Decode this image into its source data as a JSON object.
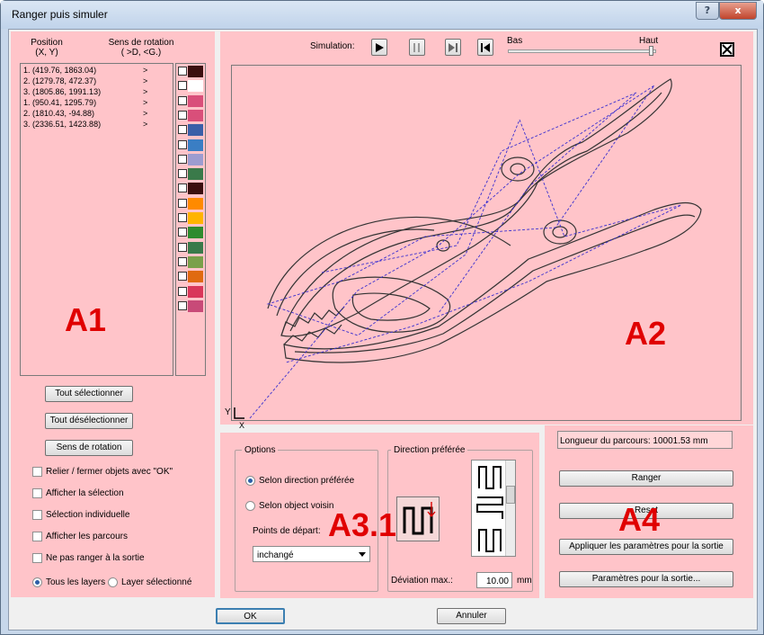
{
  "window": {
    "title": "Ranger puis simuler",
    "help_label": "?",
    "close_label": "x"
  },
  "a1": {
    "col1_header": "Position",
    "col1_sub": "(X, Y)",
    "col2_header": "Sens de rotation",
    "col2_sub": "( >D, <G.)",
    "rows": [
      {
        "pos": "1. (419.76, 1863.04)",
        "dir": ">"
      },
      {
        "pos": "2. (1279.78, 472.37)",
        "dir": ">"
      },
      {
        "pos": "3. (1805.86, 1991.13)",
        "dir": ">"
      },
      {
        "pos": "1. (950.41, 1295.79)",
        "dir": ">"
      },
      {
        "pos": "2. (1810.43, -94.88)",
        "dir": ">"
      },
      {
        "pos": "3. (2336.51, 1423.88)",
        "dir": ">"
      }
    ],
    "label": "A1",
    "layer_colors": [
      "#3b0f0f",
      "#ffffff",
      "#d94f7a",
      "#d94f7a",
      "#3a5fa8",
      "#3a7ec4",
      "#9d9cd0",
      "#3a7a4a",
      "#3b0f0f",
      "#ff8a00",
      "#ffb400",
      "#2e8b2e",
      "#3a7a4a",
      "#7aa04a",
      "#e06a10",
      "#d9365a",
      "#c84a78"
    ],
    "select_all": "Tout sélectionner",
    "deselect_all": "Tout désélectionner",
    "rotation": "Sens de rotation",
    "chk_link": "Relier / fermer objets avec \"OK\"",
    "chk_show_sel": "Afficher la sélection",
    "chk_indiv": "Sélection individuelle",
    "chk_paths": "Afficher les parcours",
    "chk_noorder": "Ne pas ranger à la sortie",
    "radio_all": "Tous les layers",
    "radio_sel": "Layer sélectionné"
  },
  "a2": {
    "sim_label": "Simulation:",
    "low_label": "Bas",
    "high_label": "Haut",
    "label": "A2",
    "axis_y": "Y",
    "axis_x": "X"
  },
  "a3": {
    "options_title": "Options",
    "opt_pref": "Selon direction préférée",
    "opt_neighbor": "Selon object voisin",
    "start_label": "Points de départ:",
    "start_value": "inchangé",
    "dir_title": "Direction préférée",
    "dev_label": "Déviation max.:",
    "dev_value": "10.00",
    "dev_unit": "mm",
    "label": "A3.1"
  },
  "a4": {
    "length": "Longueur du parcours: 10001.53 mm",
    "ranger": "Ranger",
    "reset": "Reset",
    "apply": "Appliquer les paramètres pour la sortie",
    "params": "Paramètres pour la sortie...",
    "label": "A4"
  },
  "footer": {
    "ok": "OK",
    "cancel": "Annuler"
  }
}
